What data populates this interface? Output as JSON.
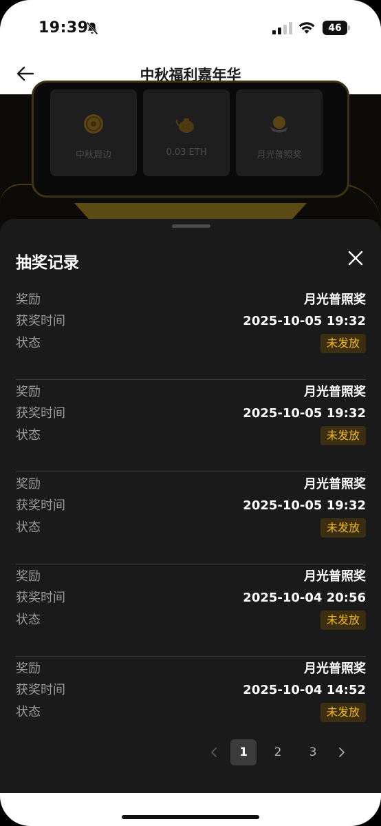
{
  "status_bar": {
    "time": "19:39",
    "battery": "46",
    "icons": [
      "bell-slash-icon",
      "cellular-signal-icon",
      "wifi-icon",
      "battery-icon"
    ]
  },
  "header": {
    "title": "中秋福利嘉年华",
    "back_icon": "arrow-left-icon"
  },
  "background_prizes": [
    {
      "label": "中秋周边",
      "icon": "mooncake-icon"
    },
    {
      "label": "0.03 ETH",
      "icon": "teapot-icon"
    },
    {
      "label": "月光普照奖",
      "icon": "moon-basket-icon"
    }
  ],
  "sheet": {
    "title": "抽奖记录",
    "close_icon": "close-icon",
    "labels": {
      "reward": "奖励",
      "time": "获奖时间",
      "status": "状态"
    },
    "records": [
      {
        "reward": "月光普照奖",
        "time": "2025-10-05 19:32",
        "status": "未发放"
      },
      {
        "reward": "月光普照奖",
        "time": "2025-10-05 19:32",
        "status": "未发放"
      },
      {
        "reward": "月光普照奖",
        "time": "2025-10-05 19:32",
        "status": "未发放"
      },
      {
        "reward": "月光普照奖",
        "time": "2025-10-04 20:56",
        "status": "未发放"
      },
      {
        "reward": "月光普照奖",
        "time": "2025-10-04 14:52",
        "status": "未发放"
      }
    ]
  },
  "pagination": {
    "pages": [
      "1",
      "2",
      "3"
    ],
    "current": "1",
    "prev_icon": "chevron-left-icon",
    "next_icon": "chevron-right-icon"
  },
  "colors": {
    "sheet_bg": "#1a1a1a",
    "badge_bg": "#3c2e10",
    "badge_text": "#f1b81d",
    "divider": "#3a3a3a",
    "label_text": "#9a9a9a"
  }
}
